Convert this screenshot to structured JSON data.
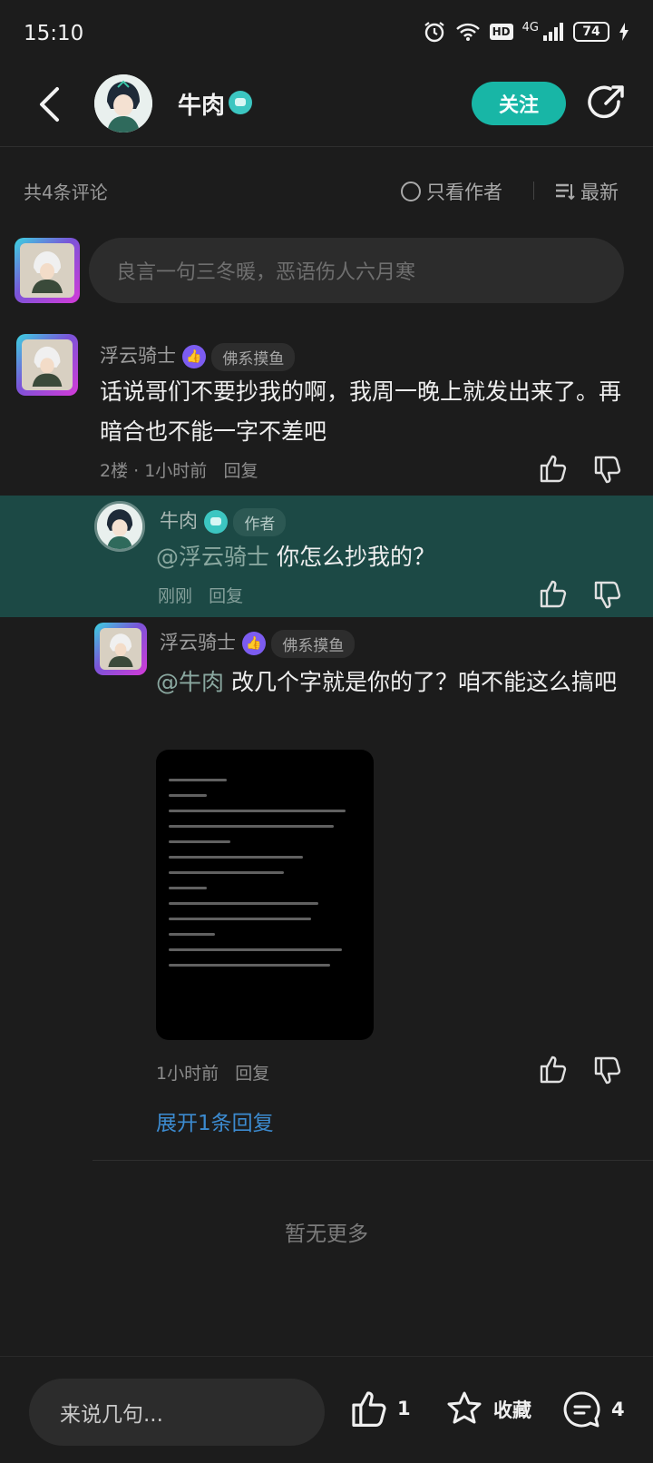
{
  "status": {
    "time": "15:10",
    "network": "4G",
    "hd": "HD",
    "battery": "74"
  },
  "header": {
    "name": "牛肉",
    "follow_label": "关注"
  },
  "filter": {
    "count": "共4条评论",
    "author_only": "只看作者",
    "sort": "最新"
  },
  "input": {
    "placeholder": "良言一句三冬暖，恶语伤人六月寒"
  },
  "comments": [
    {
      "name": "浮云骑士",
      "tag": "佛系摸鱼",
      "text": "话说哥们不要抄我的啊，我周一晚上就发出来了。再暗合也不能一字不差吧",
      "floor": "2楼",
      "time": "1小时前",
      "reply": "回复"
    },
    {
      "name": "牛肉",
      "tag": "作者",
      "mention": "@浮云骑士",
      "text": "你怎么抄我的？",
      "time": "刚刚",
      "reply": "回复"
    },
    {
      "name": "浮云骑士",
      "tag": "佛系摸鱼",
      "mention": "@牛肉",
      "text": "改几个字就是你的了？咱不能这么搞吧",
      "time": "1小时前",
      "reply": "回复"
    }
  ],
  "expand_label": "展开1条回复",
  "no_more": "暂无更多",
  "bottom": {
    "placeholder": "来说几句...",
    "like_count": "1",
    "collect_label": "收藏",
    "comment_count": "4"
  },
  "colors": {
    "accent": "#18b6a6",
    "author_bg": "#1c4945",
    "link": "#3c8bd0",
    "vip": "#7c5cf0"
  }
}
